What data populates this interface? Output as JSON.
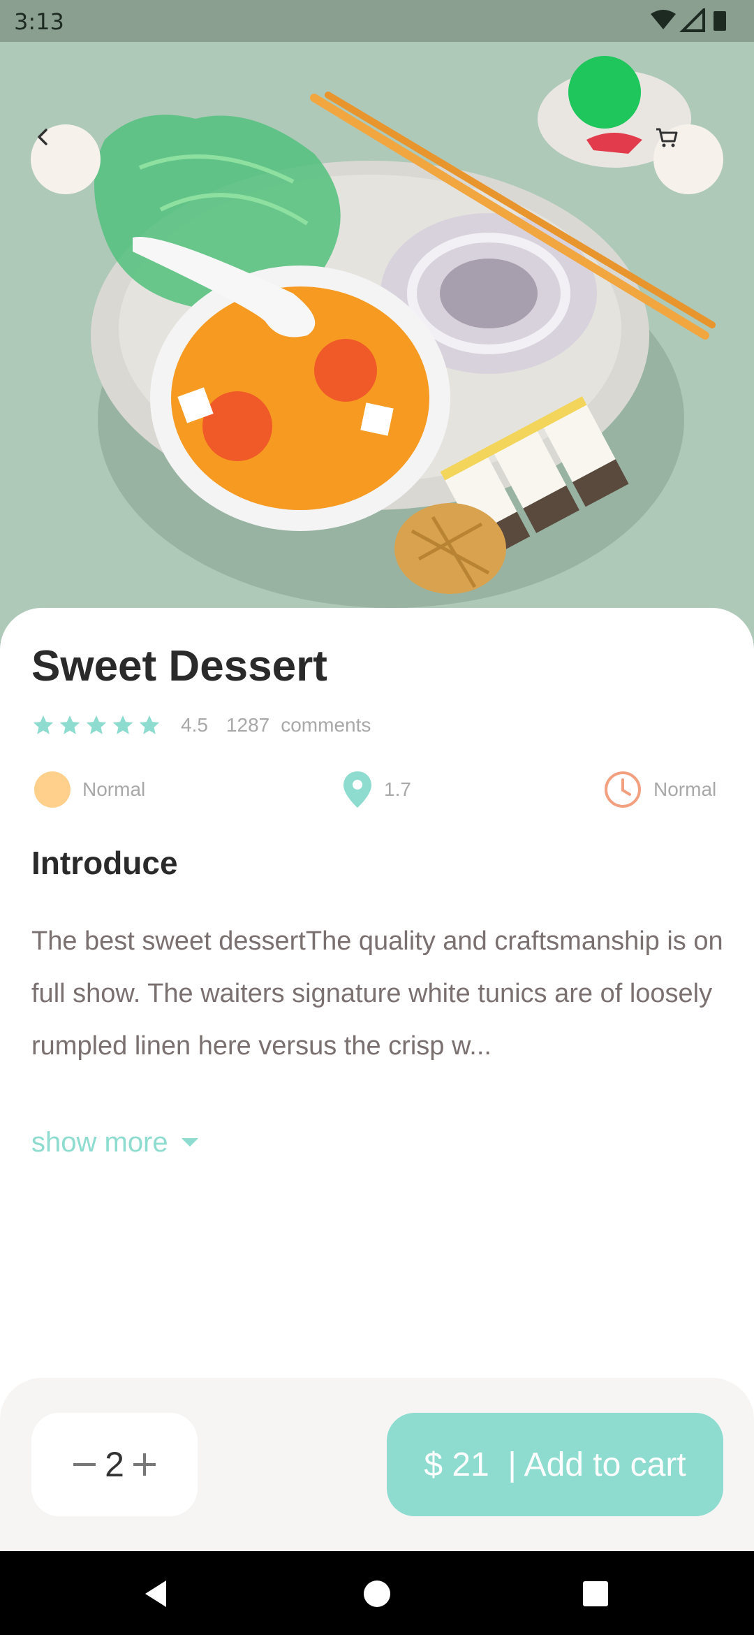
{
  "status_bar": {
    "time": "3:13",
    "icons": [
      "wifi-icon",
      "signal-icon",
      "battery-icon"
    ]
  },
  "header": {
    "back_icon": "chevron-left-icon",
    "cart_icon": "shopping-cart-icon"
  },
  "product": {
    "title": "Sweet Dessert",
    "stars": 5,
    "rating": "4.5",
    "comment_count": "1287",
    "comment_label": "comments",
    "info": {
      "level_label": "Normal",
      "distance": "1.7",
      "time_label": "Normal"
    },
    "section_title": "Introduce",
    "description": "The best sweet dessertThe quality and craftsmanship is on full show. The waiters  signature white tunics are of loosely rumpled linen here versus the crisp w...",
    "show_more": "show more"
  },
  "cart_bar": {
    "quantity": "2",
    "button_label": "$ 21  | Add to cart"
  },
  "colors": {
    "accent": "#8ddccf",
    "level_dot": "#ffd08c",
    "clock": "#f2a080",
    "star": "#8ddccf",
    "hero_bg": "#aec9b8",
    "status_bar": "#8a9f90"
  },
  "nav_bar": {
    "buttons": [
      "back-triangle-icon",
      "home-circle-icon",
      "recents-square-icon"
    ]
  }
}
